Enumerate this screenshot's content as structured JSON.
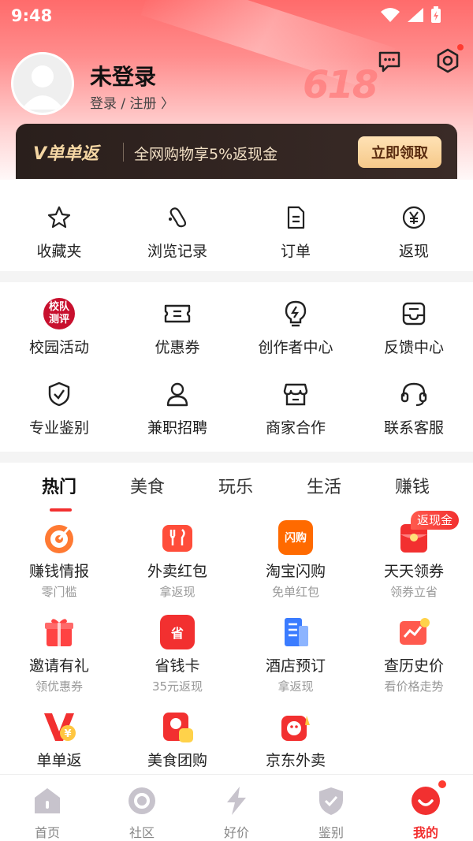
{
  "status": {
    "time": "9:48"
  },
  "profile": {
    "title": "未登录",
    "subtitle": "登录 / 注册 〉"
  },
  "decor": {
    "event_badge": "618"
  },
  "vip": {
    "logo": "V单单返",
    "text": "全网购物享5%返现金",
    "button": "立即领取"
  },
  "quick": [
    {
      "label": "收藏夹",
      "icon": "star-icon"
    },
    {
      "label": "浏览记录",
      "icon": "footprint-icon"
    },
    {
      "label": "订单",
      "icon": "document-icon"
    },
    {
      "label": "返现",
      "icon": "yen-circle-icon"
    }
  ],
  "tools": [
    {
      "label": "校园活动",
      "icon": "campus-icon",
      "icon_text_top": "校队",
      "icon_text_bottom": "测评"
    },
    {
      "label": "优惠券",
      "icon": "ticket-icon"
    },
    {
      "label": "创作者中心",
      "icon": "bulb-icon"
    },
    {
      "label": "反馈中心",
      "icon": "inbox-icon"
    },
    {
      "label": "专业鉴别",
      "icon": "shield-check-icon"
    },
    {
      "label": "兼职招聘",
      "icon": "person-icon"
    },
    {
      "label": "商家合作",
      "icon": "store-icon"
    },
    {
      "label": "联系客服",
      "icon": "headset-icon"
    }
  ],
  "tabs": [
    "热门",
    "美食",
    "玩乐",
    "生活",
    "赚钱"
  ],
  "services_badge": "返现金",
  "services": [
    {
      "label": "赚钱情报",
      "sub": "零门槛",
      "icon": "target-icon",
      "color": "#ff7a33"
    },
    {
      "label": "外卖红包",
      "sub": "拿返现",
      "icon": "takeout-bag-icon",
      "color": "#ff4d3a"
    },
    {
      "label": "淘宝闪购",
      "sub": "免单红包",
      "icon": "flash-buy-icon",
      "color": "#ff6a00",
      "icon_text": "闪购"
    },
    {
      "label": "天天领券",
      "sub": "领券立省",
      "icon": "red-envelope-icon",
      "color": "#f23030"
    },
    {
      "label": "邀请有礼",
      "sub": "领优惠券",
      "icon": "gift-icon",
      "color": "#ff4343"
    },
    {
      "label": "省钱卡",
      "sub": "35元返现",
      "icon": "save-card-icon",
      "color": "#f23030",
      "icon_text": "省"
    },
    {
      "label": "酒店预订",
      "sub": "拿返现",
      "icon": "hotel-building-icon",
      "color": "#3b7cff"
    },
    {
      "label": "查历史价",
      "sub": "看价格走势",
      "icon": "price-chart-icon",
      "color": "#ff5a4e"
    },
    {
      "label": "单单返",
      "sub": "",
      "icon": "v-coin-icon",
      "color": "#f23030"
    },
    {
      "label": "美食团购",
      "sub": "",
      "icon": "food-group-icon",
      "color": "#f23030"
    },
    {
      "label": "京东外卖",
      "sub": "",
      "icon": "jd-takeout-icon",
      "color": "#f23030"
    }
  ],
  "nav": [
    {
      "label": "首页",
      "icon": "home-icon"
    },
    {
      "label": "社区",
      "icon": "community-ring-icon"
    },
    {
      "label": "好价",
      "icon": "lightning-icon"
    },
    {
      "label": "鉴别",
      "icon": "shield-icon"
    },
    {
      "label": "我的",
      "icon": "profile-smile-icon"
    }
  ],
  "colors": {
    "accent": "#f23030",
    "vip_gold": "#f4d6a3"
  }
}
